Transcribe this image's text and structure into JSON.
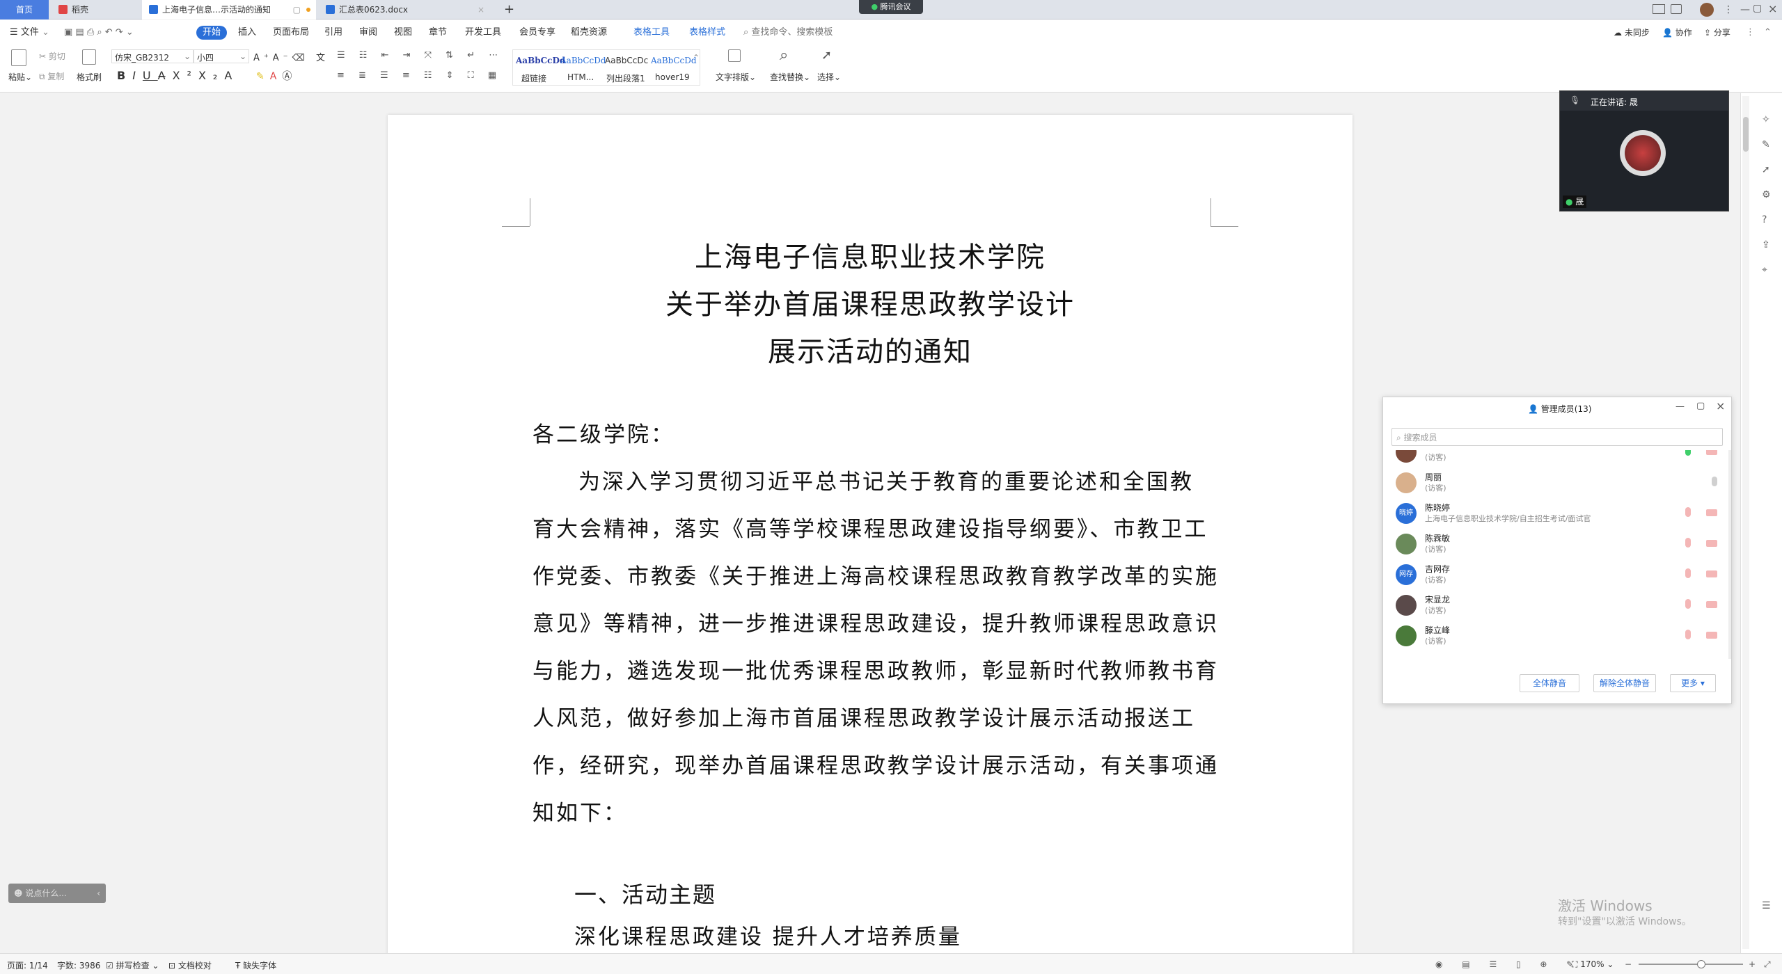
{
  "tabs": [
    {
      "label": "首页"
    },
    {
      "label": "稻壳"
    },
    {
      "label": "上海电子信息…示活动的通知"
    },
    {
      "label": "汇总表0623.docx"
    }
  ],
  "meeting_badge": "腾讯会议",
  "menu": {
    "file": "文件",
    "items": [
      "开始",
      "插入",
      "页面布局",
      "引用",
      "审阅",
      "视图",
      "章节",
      "开发工具",
      "会员专享",
      "稻壳资源",
      "表格工具",
      "表格样式"
    ],
    "search_placeholder": "查找命令、搜索模板",
    "sync": "未同步",
    "collab": "协作",
    "share": "分享"
  },
  "ribbon": {
    "paste": "粘贴",
    "cut": "剪切",
    "copy": "复制",
    "format_painter": "格式刷",
    "font_name": "仿宋_GB2312",
    "font_size": "小四",
    "styles": [
      {
        "preview": "AaBbCcDd",
        "label": "超链接"
      },
      {
        "preview": "AaBbCcDd",
        "label": "HTM..."
      },
      {
        "preview": "AaBbCcDc",
        "label": "列出段落1"
      },
      {
        "preview": "AaBbCcDd",
        "label": "hover19"
      }
    ],
    "text_layout": "文字排版",
    "find_replace": "查找替换",
    "select": "选择"
  },
  "document": {
    "title_lines": [
      "上海电子信息职业技术学院",
      "关于举办首届课程思政教学设计",
      "展示活动的通知"
    ],
    "salutation": "各二级学院：",
    "body_lines": [
      "为深入学习贯彻习近平总书记关于教育的重要论述和全国教",
      "育大会精神，落实《高等学校课程思政建设指导纲要》、市教卫工",
      "作党委、市教委《关于推进上海高校课程思政教育教学改革的实施",
      "意见》等精神，进一步推进课程思政建设，提升教师课程思政意识",
      "与能力，遴选发现一批优秀课程思政教师，彰显新时代教师教书育",
      "人风范，做好参加上海市首届课程思政教学设计展示活动报送工",
      "作，经研究，现举办首届课程思政教学设计展示活动，有关事项通",
      "知如下："
    ],
    "heading1": "一、活动主题",
    "theme": "深化课程思政建设  提升人才培养质量"
  },
  "meeting_window": {
    "speaking": "正在讲话: 晟",
    "user_tag": "晟"
  },
  "members_panel": {
    "title": "管理成员(13)",
    "search_placeholder": "搜索成员",
    "members": [
      {
        "name": "…",
        "role": "(访客)",
        "avatar_text": "",
        "avatar_color": "#7a4a3a",
        "mic_on": true
      },
      {
        "name": "周丽",
        "role": "(访客)",
        "avatar_text": "",
        "avatar_color": "#d9b08c",
        "mic_on": false
      },
      {
        "name": "陈晓婷",
        "role": "上海电子信息职业技术学院/自主招生考试/面试官",
        "avatar_text": "晓婷",
        "avatar_color": "#2a6fd8",
        "mic_on": false
      },
      {
        "name": "陈霖敏",
        "role": "(访客)",
        "avatar_text": "",
        "avatar_color": "#6a8a5a",
        "mic_on": false
      },
      {
        "name": "吉网存",
        "role": "(访客)",
        "avatar_text": "网存",
        "avatar_color": "#2a6fd8",
        "mic_on": false
      },
      {
        "name": "宋显龙",
        "role": "(访客)",
        "avatar_text": "",
        "avatar_color": "#5a4a4a",
        "mic_on": false
      },
      {
        "name": "滕立峰",
        "role": "(访客)",
        "avatar_text": "",
        "avatar_color": "#4a7a3a",
        "mic_on": false
      }
    ],
    "mute_all": "全体静音",
    "unmute_all": "解除全体静音",
    "more": "更多"
  },
  "chat_bubble": "说点什么...",
  "watermark": {
    "line1": "激活 Windows",
    "line2": "转到\"设置\"以激活 Windows。"
  },
  "status": {
    "page": "页面: 1/14",
    "words": "字数: 3986",
    "spell": "拼写检查",
    "proof": "文档校对",
    "missing_font": "缺失字体",
    "zoom": "170%"
  },
  "colors": {
    "accent": "#2a6fd8",
    "tabbar": "#dfe3ea"
  }
}
